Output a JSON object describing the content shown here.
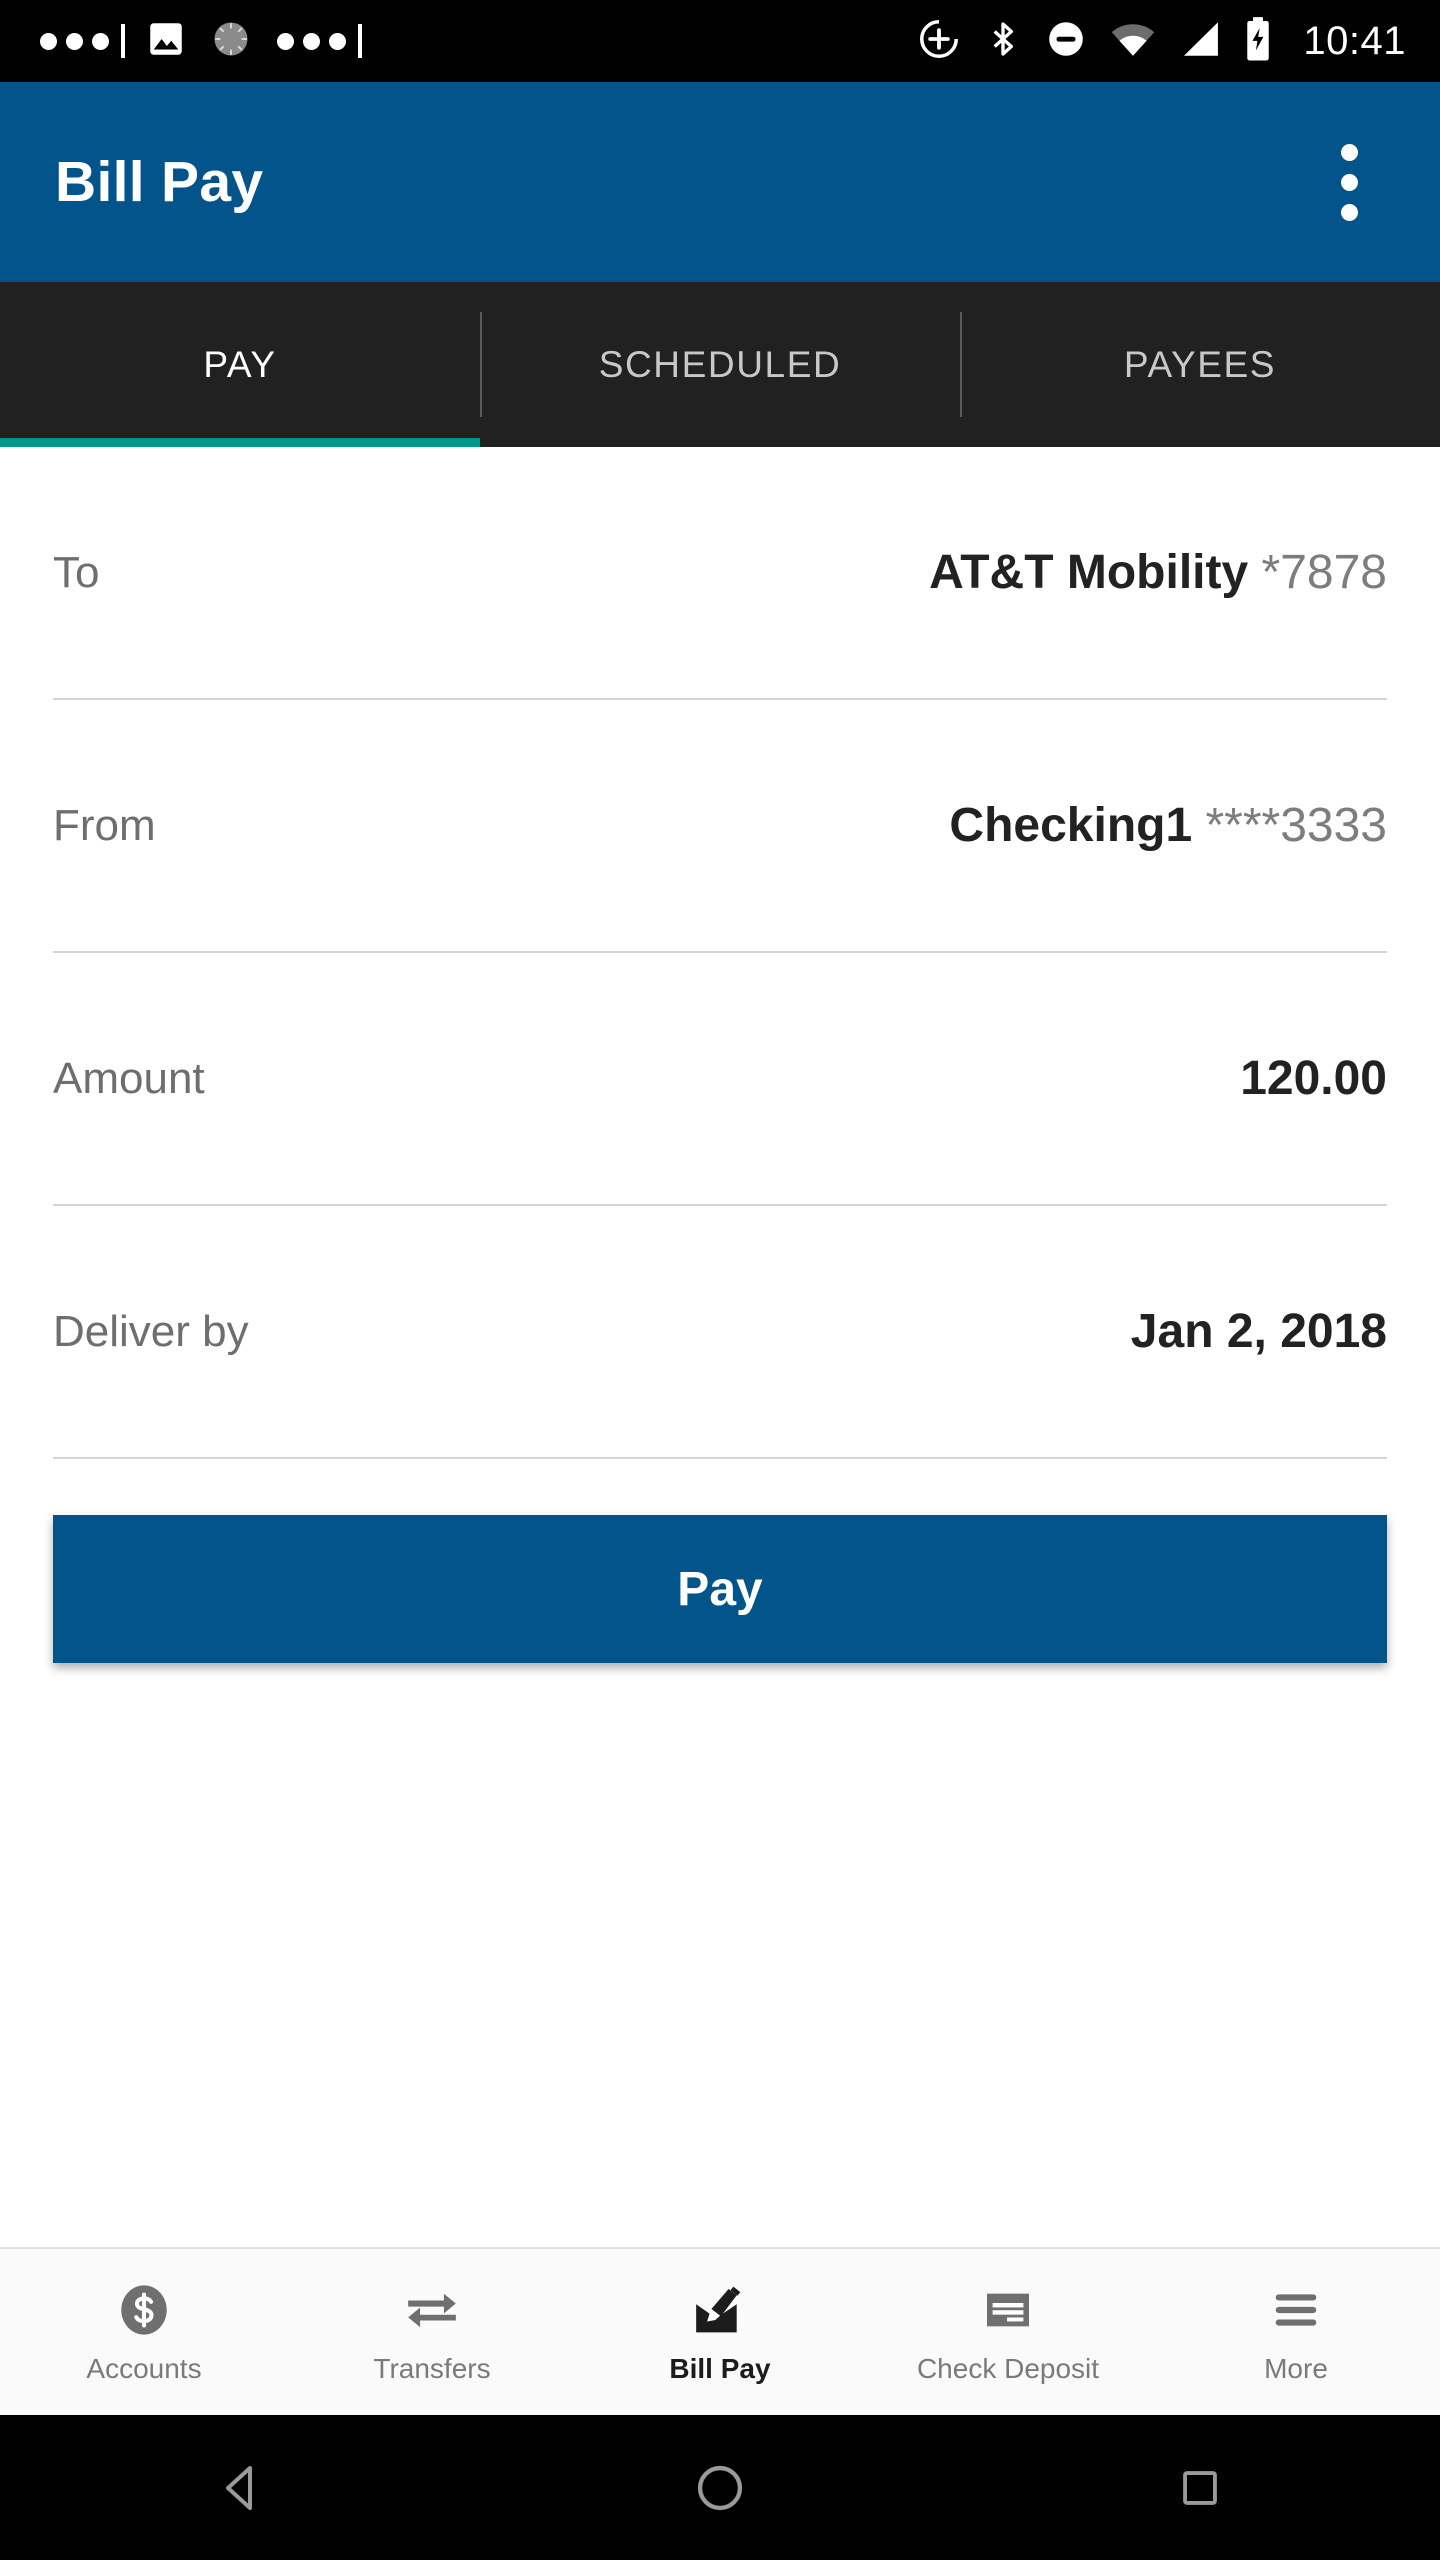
{
  "status_bar": {
    "time": "10:41",
    "left_icons": [
      "more-dots-icon",
      "image-icon",
      "sync-circle-icon",
      "more-dots-icon"
    ],
    "right_icons": [
      "add-circle-icon",
      "bluetooth-icon",
      "do-not-disturb-icon",
      "wifi-icon",
      "cellular-signal-icon",
      "battery-charging-icon"
    ]
  },
  "app_bar": {
    "title": "Bill Pay",
    "overflow_icon": "overflow-menu-icon"
  },
  "tabs": {
    "active_index": 0,
    "items": [
      {
        "label": "PAY"
      },
      {
        "label": "SCHEDULED"
      },
      {
        "label": "PAYEES"
      }
    ],
    "indicator_color": "#009688"
  },
  "form": {
    "rows": [
      {
        "label": "To",
        "value_strong": "AT&T Mobility",
        "value_muted": "*7878"
      },
      {
        "label": "From",
        "value_strong": "Checking1",
        "value_muted": "****3333"
      },
      {
        "label": "Amount",
        "value_strong": "120.00",
        "value_muted": ""
      },
      {
        "label": "Deliver by",
        "value_strong": "Jan 2, 2018",
        "value_muted": ""
      }
    ],
    "submit_label": "Pay"
  },
  "bottom_nav": {
    "active_index": 2,
    "items": [
      {
        "label": "Accounts",
        "icon": "dollar-circle-icon"
      },
      {
        "label": "Transfers",
        "icon": "transfer-arrows-icon"
      },
      {
        "label": "Bill Pay",
        "icon": "envelope-pen-icon"
      },
      {
        "label": "Check Deposit",
        "icon": "check-document-icon"
      },
      {
        "label": "More",
        "icon": "hamburger-menu-icon"
      }
    ]
  },
  "android_nav": {
    "back_label": "back-triangle-icon",
    "home_label": "home-circle-icon",
    "recents_label": "recents-square-icon"
  },
  "colors": {
    "brand_blue": "#03548A",
    "tab_bar": "#212121",
    "accent_teal": "#009688"
  }
}
